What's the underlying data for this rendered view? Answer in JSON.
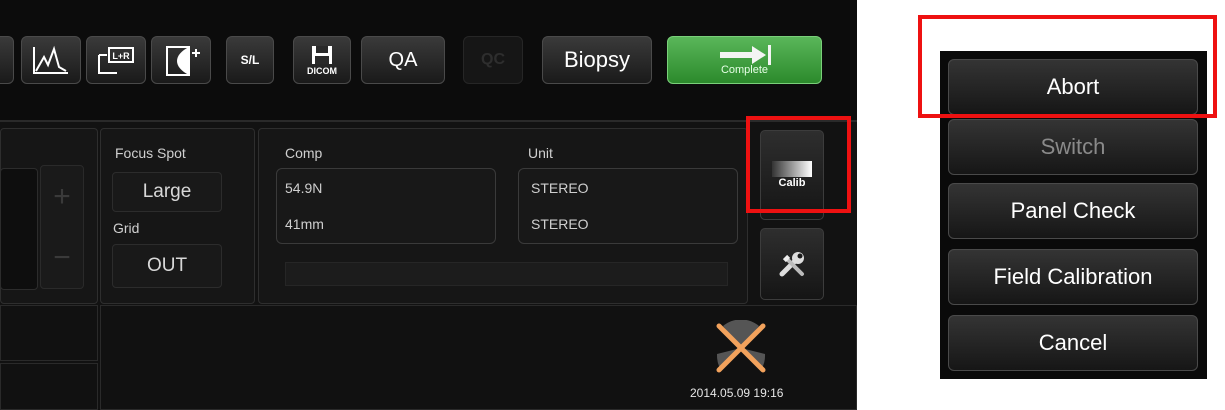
{
  "toolbar": {
    "sl_label": "S/L",
    "dicom_label": "DICOM",
    "qa_label": "QA",
    "qc_label": "QC",
    "biopsy_label": "Biopsy",
    "complete_label": "Complete"
  },
  "exposure": {
    "focus_spot_label": "Focus Spot",
    "focus_spot_value": "Large",
    "grid_label": "Grid",
    "grid_value": "OUT",
    "comp_label": "Comp",
    "comp_force": "54.9N",
    "comp_thickness": "41mm",
    "unit_label": "Unit",
    "unit_value_1": "STEREO",
    "unit_value_2": "STEREO",
    "plus": "+",
    "minus": "−"
  },
  "side": {
    "calib_label": "Calib"
  },
  "status": {
    "datetime": "2014.05.09 19:16"
  },
  "menu": {
    "items": [
      "Abort",
      "Switch",
      "Panel Check",
      "Field Calibration",
      "Cancel"
    ]
  },
  "colors": {
    "highlight": "#ee1111",
    "complete_green": "#3fa43f",
    "x_mark": "#f2a25c"
  }
}
